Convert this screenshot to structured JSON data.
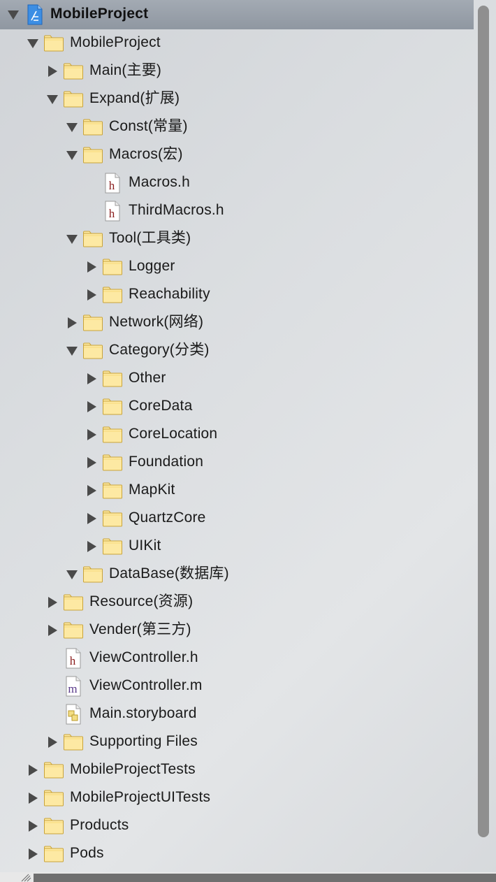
{
  "navigator": {
    "rows": [
      {
        "name": "MobileProject",
        "kind": "project",
        "depth": 0,
        "disclosure": "expanded",
        "selected": true
      },
      {
        "name": "MobileProject",
        "kind": "folder",
        "depth": 1,
        "disclosure": "expanded"
      },
      {
        "name": "Main(主要)",
        "kind": "folder",
        "depth": 2,
        "disclosure": "collapsed"
      },
      {
        "name": "Expand(扩展)",
        "kind": "folder",
        "depth": 2,
        "disclosure": "expanded"
      },
      {
        "name": "Const(常量)",
        "kind": "folder",
        "depth": 3,
        "disclosure": "expanded"
      },
      {
        "name": "Macros(宏)",
        "kind": "folder",
        "depth": 3,
        "disclosure": "expanded"
      },
      {
        "name": "Macros.h",
        "kind": "header-file",
        "depth": 4,
        "disclosure": "none"
      },
      {
        "name": "ThirdMacros.h",
        "kind": "header-file",
        "depth": 4,
        "disclosure": "none"
      },
      {
        "name": "Tool(工具类)",
        "kind": "folder",
        "depth": 3,
        "disclosure": "expanded"
      },
      {
        "name": "Logger",
        "kind": "folder",
        "depth": 4,
        "disclosure": "collapsed"
      },
      {
        "name": "Reachability",
        "kind": "folder",
        "depth": 4,
        "disclosure": "collapsed"
      },
      {
        "name": "Network(网络)",
        "kind": "folder",
        "depth": 3,
        "disclosure": "collapsed"
      },
      {
        "name": "Category(分类)",
        "kind": "folder",
        "depth": 3,
        "disclosure": "expanded"
      },
      {
        "name": "Other",
        "kind": "folder",
        "depth": 4,
        "disclosure": "collapsed"
      },
      {
        "name": "CoreData",
        "kind": "folder",
        "depth": 4,
        "disclosure": "collapsed"
      },
      {
        "name": "CoreLocation",
        "kind": "folder",
        "depth": 4,
        "disclosure": "collapsed"
      },
      {
        "name": "Foundation",
        "kind": "folder",
        "depth": 4,
        "disclosure": "collapsed"
      },
      {
        "name": "MapKit",
        "kind": "folder",
        "depth": 4,
        "disclosure": "collapsed"
      },
      {
        "name": "QuartzCore",
        "kind": "folder",
        "depth": 4,
        "disclosure": "collapsed"
      },
      {
        "name": "UIKit",
        "kind": "folder",
        "depth": 4,
        "disclosure": "collapsed"
      },
      {
        "name": "DataBase(数据库)",
        "kind": "folder",
        "depth": 3,
        "disclosure": "expanded"
      },
      {
        "name": "Resource(资源)",
        "kind": "folder",
        "depth": 2,
        "disclosure": "collapsed"
      },
      {
        "name": "Vender(第三方)",
        "kind": "folder",
        "depth": 2,
        "disclosure": "collapsed"
      },
      {
        "name": "ViewController.h",
        "kind": "header-file",
        "depth": 2,
        "disclosure": "none"
      },
      {
        "name": "ViewController.m",
        "kind": "impl-file",
        "depth": 2,
        "disclosure": "none"
      },
      {
        "name": "Main.storyboard",
        "kind": "storyboard-file",
        "depth": 2,
        "disclosure": "none"
      },
      {
        "name": "Supporting Files",
        "kind": "folder",
        "depth": 2,
        "disclosure": "collapsed"
      },
      {
        "name": "MobileProjectTests",
        "kind": "folder",
        "depth": 1,
        "disclosure": "collapsed"
      },
      {
        "name": "MobileProjectUITests",
        "kind": "folder",
        "depth": 1,
        "disclosure": "collapsed"
      },
      {
        "name": "Products",
        "kind": "folder",
        "depth": 1,
        "disclosure": "collapsed"
      },
      {
        "name": "Pods",
        "kind": "folder",
        "depth": 1,
        "disclosure": "collapsed"
      }
    ]
  },
  "colors": {
    "selection": "#98a0aa",
    "folder_fill": "#fde9a3",
    "folder_stroke": "#c9a338",
    "disclosure": "#4a4a4a",
    "header_letter": "#8a1c1c",
    "impl_letter": "#5a3a8a"
  }
}
